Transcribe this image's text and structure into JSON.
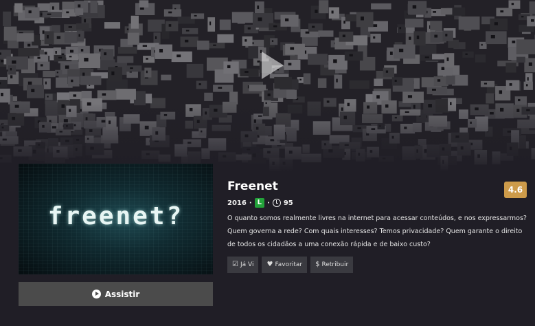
{
  "hero": {
    "play_icon": "play-icon"
  },
  "poster": {
    "text": "freenet?"
  },
  "watch_button": {
    "label": "Assistir",
    "icon": "play-circle-icon"
  },
  "movie": {
    "title": "Freenet",
    "year": "2016",
    "separator": "·",
    "classification": "L",
    "classification_color": "#23a33a",
    "duration": "95",
    "rating": "4.6",
    "rating_color": "#cd9b4a",
    "synopsis": "O quanto somos realmente livres na internet para acessar conteúdos, e nos expressarmos? Quem governa a rede? Com quais interesses? Temos privacidade? Quem garante o direito de todos os cidadãos a uma conexão rápida e de baixo custo?"
  },
  "actions": {
    "seen": {
      "label": "Já Vi",
      "icon": "check-square-icon"
    },
    "favorite": {
      "label": "Favoritar",
      "icon": "heart-icon"
    },
    "retribute": {
      "label": "Retribuir",
      "icon": "dollar-icon"
    }
  }
}
